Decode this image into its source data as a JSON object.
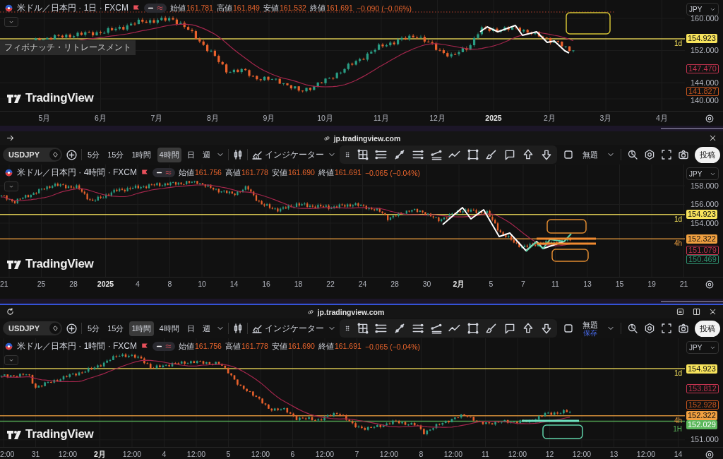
{
  "sections": [
    {
      "kind": "chart",
      "legend": {
        "title": "米ドル／日本円 · 1日 · FXCM",
        "expanded": true,
        "values": [
          {
            "label": "始値",
            "value": "161.781"
          },
          {
            "label": "高値",
            "value": "161.849"
          },
          {
            "label": "安値",
            "value": "161.532"
          },
          {
            "label": "終値",
            "value": "161.691"
          }
        ],
        "change": "−0.090 (−0.06%)"
      },
      "drawing_label": "フィボナッチ・リトレースメント",
      "logo": "TradingView",
      "currency": "JPY",
      "prices": [
        {
          "text": "160.000",
          "kind": "tick"
        },
        {
          "text": "154.923",
          "kind": "badge",
          "color": "#f7e35c",
          "tag": "1d"
        },
        {
          "text": "152.000",
          "kind": "tick"
        },
        {
          "text": "147.470",
          "kind": "outline",
          "color": "#c2334f"
        },
        {
          "text": "144.000",
          "kind": "tick"
        },
        {
          "text": "141.827",
          "kind": "outline",
          "color": "#c4541e"
        },
        {
          "text": "140.000",
          "kind": "tick"
        }
      ],
      "time_labels": [
        {
          "label": "5月",
          "major": false
        },
        {
          "label": "6月",
          "major": false
        },
        {
          "label": "7月",
          "major": false
        },
        {
          "label": "8月",
          "major": false
        },
        {
          "label": "9月",
          "major": false
        },
        {
          "label": "10月",
          "major": false
        },
        {
          "label": "11月",
          "major": false
        },
        {
          "label": "12月",
          "major": false
        },
        {
          "label": "2025",
          "major": true
        },
        {
          "label": "2月",
          "major": false
        },
        {
          "label": "3月",
          "major": false
        },
        {
          "label": "4月",
          "major": false
        }
      ]
    },
    {
      "kind": "address_bar",
      "url": "jp.tradingview.com"
    },
    {
      "kind": "toolbar",
      "symbol": "USDJPY",
      "timeframes": [
        {
          "label": "5分",
          "selected": false
        },
        {
          "label": "15分",
          "selected": false
        },
        {
          "label": "1時間",
          "selected": false
        },
        {
          "label": "4時間",
          "selected": true
        },
        {
          "label": "日",
          "selected": false
        },
        {
          "label": "週",
          "selected": false
        }
      ],
      "indicators": "インジケーター",
      "layout_name": "無題",
      "publish": "投稿"
    },
    {
      "kind": "chart",
      "legend": {
        "title": "米ドル／日本円 · 4時間 · FXCM",
        "expanded": true,
        "values": [
          {
            "label": "始値",
            "value": "161.756"
          },
          {
            "label": "高値",
            "value": "161.778"
          },
          {
            "label": "安値",
            "value": "161.690"
          },
          {
            "label": "終値",
            "value": "161.691"
          }
        ],
        "change": "−0.065 (−0.04%)"
      },
      "logo": "TradingView",
      "currency": "JPY",
      "prices": [
        {
          "text": "158.000",
          "kind": "tick"
        },
        {
          "text": "156.000",
          "kind": "tick"
        },
        {
          "text": "154.923",
          "kind": "badge",
          "color": "#f7e35c",
          "tag": "1d"
        },
        {
          "text": "154.000",
          "kind": "tick"
        },
        {
          "text": "152.322",
          "kind": "badge",
          "color": "#f0a040",
          "tag": "4h"
        },
        {
          "text": "151.079",
          "kind": "outline",
          "color": "#c2334f"
        },
        {
          "text": "150.469",
          "kind": "outline",
          "color": "#2f8f6f"
        }
      ],
      "time_labels": [
        {
          "label": "21",
          "major": false
        },
        {
          "label": "25",
          "major": false
        },
        {
          "label": "28",
          "major": false
        },
        {
          "label": "2025",
          "major": true
        },
        {
          "label": "4",
          "major": false
        },
        {
          "label": "8",
          "major": false
        },
        {
          "label": "10",
          "major": false
        },
        {
          "label": "14",
          "major": false
        },
        {
          "label": "16",
          "major": false
        },
        {
          "label": "18",
          "major": false
        },
        {
          "label": "22",
          "major": false
        },
        {
          "label": "24",
          "major": false
        },
        {
          "label": "28",
          "major": false
        },
        {
          "label": "30",
          "major": false
        },
        {
          "label": "2月",
          "major": true
        },
        {
          "label": "5",
          "major": false
        },
        {
          "label": "7",
          "major": false
        },
        {
          "label": "11",
          "major": false
        },
        {
          "label": "13",
          "major": false
        },
        {
          "label": "15",
          "major": false
        },
        {
          "label": "19",
          "major": false
        },
        {
          "label": "21",
          "major": false
        }
      ]
    },
    {
      "kind": "address_bar",
      "url": "jp.tradingview.com"
    },
    {
      "kind": "toolbar",
      "symbol": "USDJPY",
      "timeframes": [
        {
          "label": "5分",
          "selected": false
        },
        {
          "label": "15分",
          "selected": false
        },
        {
          "label": "1時間",
          "selected": true
        },
        {
          "label": "4時間",
          "selected": false
        },
        {
          "label": "日",
          "selected": false
        },
        {
          "label": "週",
          "selected": false
        }
      ],
      "indicators": "インジケーター",
      "layout_name": "無題",
      "layout_status": "保存",
      "publish": "投稿"
    },
    {
      "kind": "chart",
      "legend": {
        "title": "米ドル／日本円 · 1時間 · FXCM",
        "expanded": true,
        "values": [
          {
            "label": "始値",
            "value": "161.756"
          },
          {
            "label": "高値",
            "value": "161.778"
          },
          {
            "label": "安値",
            "value": "161.690"
          },
          {
            "label": "終値",
            "value": "161.691"
          }
        ],
        "change": "−0.065 (−0.04%)"
      },
      "logo": "TradingView",
      "currency": "JPY",
      "prices": [
        {
          "text": "154.923",
          "kind": "badge",
          "color": "#f7e35c",
          "tag": "1d"
        },
        {
          "text": "153.812",
          "kind": "outline",
          "color": "#c2334f"
        },
        {
          "text": "152.928",
          "kind": "outline",
          "color": "#c4541e"
        },
        {
          "text": "152.322",
          "kind": "badge",
          "color": "#f0a040",
          "tag": "4h"
        },
        {
          "text": "152.029",
          "kind": "badge",
          "color": "#5cb85c",
          "tag": "1H"
        },
        {
          "text": "151.000",
          "kind": "tick"
        }
      ],
      "time_labels": [
        {
          "label": "2:00",
          "major": false
        },
        {
          "label": "31",
          "major": false
        },
        {
          "label": "12:00",
          "major": false
        },
        {
          "label": "2月",
          "major": true
        },
        {
          "label": "12:00",
          "major": false
        },
        {
          "label": "4",
          "major": false
        },
        {
          "label": "12:00",
          "major": false
        },
        {
          "label": "5",
          "major": false
        },
        {
          "label": "12:00",
          "major": false
        },
        {
          "label": "6",
          "major": false
        },
        {
          "label": "12:00",
          "major": false
        },
        {
          "label": "7",
          "major": false
        },
        {
          "label": "12:00",
          "major": false
        },
        {
          "label": "8",
          "major": false
        },
        {
          "label": "12:00",
          "major": false
        },
        {
          "label": "11",
          "major": false
        },
        {
          "label": "12:00",
          "major": false
        },
        {
          "label": "12",
          "major": false
        },
        {
          "label": "12:00",
          "major": false
        },
        {
          "label": "13",
          "major": false
        },
        {
          "label": "12:00",
          "major": false
        },
        {
          "label": "14",
          "major": false
        }
      ]
    }
  ]
}
